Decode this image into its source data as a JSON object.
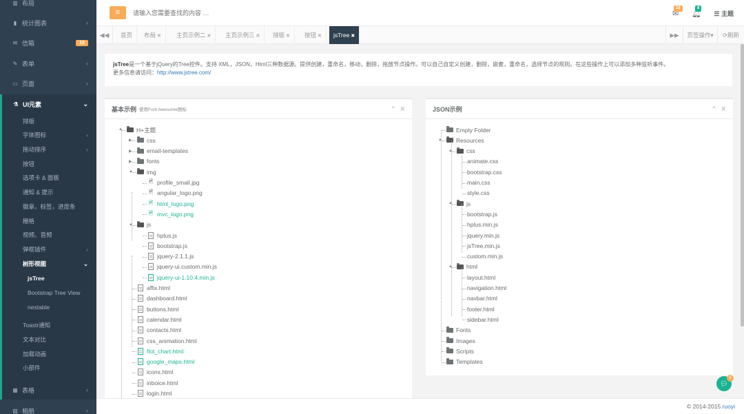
{
  "sidebar": {
    "items": [
      {
        "label": "布局",
        "icon": "columns-icon"
      },
      {
        "label": "统计图表",
        "icon": "bar-chart-icon"
      },
      {
        "label": "信箱",
        "icon": "envelope-icon",
        "badge": "16"
      },
      {
        "label": "表单",
        "icon": "edit-icon"
      },
      {
        "label": "页面",
        "icon": "desktop-icon"
      },
      {
        "label": "UI元素",
        "icon": "flask-icon"
      },
      {
        "label": "表格",
        "icon": "table-icon"
      },
      {
        "label": "相册",
        "icon": "picture-icon"
      }
    ],
    "ui_sub": [
      "排版",
      "字体图标",
      "拖动排序",
      "按钮",
      "选项卡 & 面板",
      "通知 & 提示",
      "徽章，标签，进度条",
      "栅格",
      "视频、音频",
      "弹框插件",
      "树形视图"
    ],
    "tree_sub": [
      "jsTree",
      "Bootstrap Tree View",
      "nestable"
    ],
    "ui_sub2": [
      "Toastr通知",
      "文本对比",
      "加载动画",
      "小部件"
    ]
  },
  "topbar": {
    "search_placeholder": "请输入您需要查找的内容 …",
    "mail_count": "16",
    "alert_count": "8",
    "theme_label": "主题"
  },
  "tabs": [
    {
      "label": "首页",
      "closable": false
    },
    {
      "label": "布局",
      "closable": true
    },
    {
      "label": "主页示例二",
      "closable": true
    },
    {
      "label": "主页示例三",
      "closable": true
    },
    {
      "label": "排版",
      "closable": true
    },
    {
      "label": "按钮",
      "closable": true
    },
    {
      "label": "jsTree",
      "closable": true,
      "active": true
    }
  ],
  "tab_actions": {
    "menu": "页签操作",
    "refresh": "刷新"
  },
  "intro": {
    "name": "jsTree",
    "text": "是一个基于jQuery的Tree控件。支持 XML，JSON，Html三种数据源。提供创建，重命名，移动，删除，拖放节点操作。可以自己自定义创建，删除，嵌套，重命名，选择节点的规则。在这些操作上可以添加多种监听事件。",
    "more_label": "更多信息请访问：",
    "link": "http://www.jstree.com/"
  },
  "basic_panel": {
    "title": "基本示例",
    "subtitle": "使用Font Awesome图标",
    "tree": [
      {
        "label": "H+主题",
        "type": "folder-open",
        "level": 0
      },
      {
        "label": "css",
        "type": "folder",
        "level": 1
      },
      {
        "label": "email-templates",
        "type": "folder",
        "level": 1
      },
      {
        "label": "fonts",
        "type": "folder",
        "level": 1
      },
      {
        "label": "img",
        "type": "folder-open",
        "level": 1
      },
      {
        "label": "profile_small.jpg",
        "type": "image",
        "level": 2
      },
      {
        "label": "angular_logo.png",
        "type": "image",
        "level": 2
      },
      {
        "label": "html_logo.png",
        "type": "image",
        "level": 2,
        "green": true
      },
      {
        "label": "mvc_logo.png",
        "type": "image",
        "level": 2,
        "green": true
      },
      {
        "label": "js",
        "type": "folder-open",
        "level": 1
      },
      {
        "label": "hplus.js",
        "type": "file",
        "level": 2
      },
      {
        "label": "bootstrap.js",
        "type": "file",
        "level": 2
      },
      {
        "label": "jquery-2.1.1.js",
        "type": "file",
        "level": 2
      },
      {
        "label": "jquery-ui.custom.min.js",
        "type": "file",
        "level": 2
      },
      {
        "label": "jquery-ui-1.10.4.min.js",
        "type": "file",
        "level": 2,
        "green": true
      },
      {
        "label": "affix.html",
        "type": "file",
        "level": 1
      },
      {
        "label": "dashboard.html",
        "type": "file",
        "level": 1
      },
      {
        "label": "buttons.html",
        "type": "file",
        "level": 1
      },
      {
        "label": "calendar.html",
        "type": "file",
        "level": 1
      },
      {
        "label": "contacts.html",
        "type": "file",
        "level": 1
      },
      {
        "label": "css_animation.html",
        "type": "file",
        "level": 1
      },
      {
        "label": "flot_chart.html",
        "type": "file",
        "level": 1,
        "green": true
      },
      {
        "label": "google_maps.html",
        "type": "file",
        "level": 1,
        "green": true
      },
      {
        "label": "icons.html",
        "type": "file",
        "level": 1
      },
      {
        "label": "inboice.html",
        "type": "file",
        "level": 1
      },
      {
        "label": "login.html",
        "type": "file",
        "level": 1
      }
    ]
  },
  "json_panel": {
    "title": "JSON示例",
    "tree": [
      {
        "label": "Empty Folder",
        "type": "folder",
        "level": 0
      },
      {
        "label": "Resources",
        "type": "folder-open",
        "level": 0
      },
      {
        "label": "css",
        "type": "folder-open",
        "level": 1
      },
      {
        "label": "animate.css",
        "type": "leaf",
        "level": 2
      },
      {
        "label": "bootstrap.css",
        "type": "leaf",
        "level": 2
      },
      {
        "label": "main.css",
        "type": "leaf",
        "level": 2
      },
      {
        "label": "style.css",
        "type": "leaf",
        "level": 2
      },
      {
        "label": "js",
        "type": "folder-open",
        "level": 1
      },
      {
        "label": "bootstrap.js",
        "type": "leaf",
        "level": 2
      },
      {
        "label": "hplus.min.js",
        "type": "leaf",
        "level": 2
      },
      {
        "label": "jquery.min.js",
        "type": "leaf",
        "level": 2
      },
      {
        "label": "jsTree.min.js",
        "type": "leaf",
        "level": 2
      },
      {
        "label": "custom.min.js",
        "type": "leaf",
        "level": 2
      },
      {
        "label": "html",
        "type": "folder-open",
        "level": 1
      },
      {
        "label": "layout.html",
        "type": "leaf",
        "level": 2
      },
      {
        "label": "navigation.html",
        "type": "leaf",
        "level": 2
      },
      {
        "label": "navbar.html",
        "type": "leaf",
        "level": 2
      },
      {
        "label": "footer.html",
        "type": "leaf",
        "level": 2
      },
      {
        "label": "sidebar.html",
        "type": "leaf",
        "level": 2
      },
      {
        "label": "Fonts",
        "type": "folder",
        "level": 0
      },
      {
        "label": "Images",
        "type": "folder",
        "level": 0
      },
      {
        "label": "Scripts",
        "type": "folder",
        "level": 0
      },
      {
        "label": "Templates",
        "type": "folder",
        "level": 0
      }
    ]
  },
  "footer": {
    "copyright": "© 2014-2015",
    "link": "ruoyi"
  },
  "chat_badge": "5",
  "colors": {
    "sidebar": "#2f4050",
    "accent": "#1ab394",
    "orange": "#f8ac59",
    "active_tab": "#2f4050"
  }
}
